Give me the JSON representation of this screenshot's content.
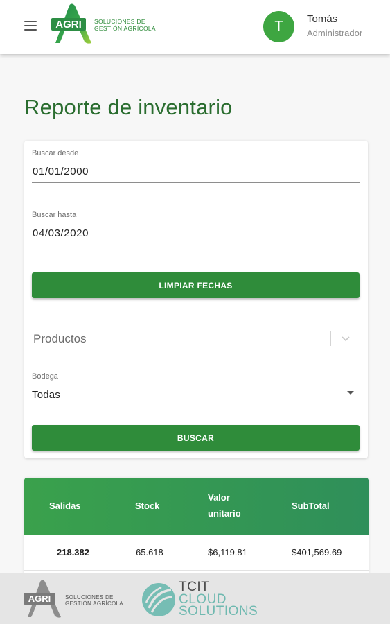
{
  "header": {
    "brand_mark": "AGRI",
    "brand_line1": "Soluciones de",
    "brand_line2": "Gestión Agrícola",
    "avatar_letter": "T",
    "user_name": "Tomás",
    "user_role": "Administrador"
  },
  "page": {
    "title": "Reporte de inventario"
  },
  "filters": {
    "desde_label": "Buscar desde",
    "desde_value": "01/01/2000",
    "hasta_label": "Buscar hasta",
    "hasta_value": "04/03/2020",
    "clear_button": "LIMPIAR FECHAS",
    "productos_placeholder": "Productos",
    "bodega_label": "Bodega",
    "bodega_value": "Todas",
    "search_button": "BUSCAR"
  },
  "table": {
    "headers": [
      "Salidas",
      "Stock",
      "Valor\nunitario",
      "SubTotal"
    ],
    "rows": [
      [
        "218.382",
        "65.618",
        "$6,119.81",
        "$401,569.69"
      ]
    ]
  },
  "footer": {
    "brand_mark": "AGRI",
    "brand_line1": "Soluciones de",
    "brand_line2": "Gestión Agrícola",
    "partner_line1": "TCIT",
    "partner_line2": "CLOUD",
    "partner_line3": "SOLUTIONS"
  },
  "colors": {
    "brand_green": "#2f8c3a",
    "title_green": "#2a6d2f",
    "avatar_green": "#3ea641",
    "partner_teal": "#6fb9b0"
  },
  "icons": [
    "menu-icon",
    "agri-logo-icon",
    "chevron-down-icon",
    "dropdown-arrow-icon",
    "tcit-logo-icon"
  ]
}
